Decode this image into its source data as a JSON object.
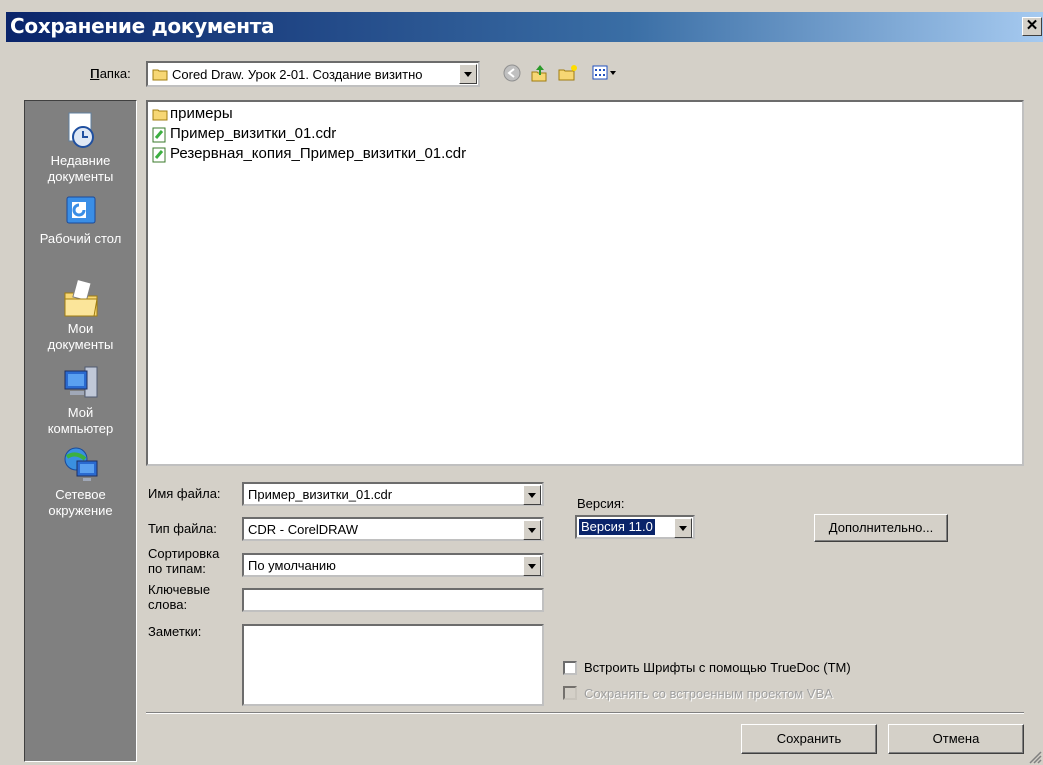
{
  "window": {
    "title": "Сохранение документа",
    "close_glyph": "✕"
  },
  "folder": {
    "label": "Папка:",
    "value": "Cored Draw. Урок 2-01. Создание визитно"
  },
  "places": [
    {
      "label_line1": "Недавние",
      "label_line2": "документы",
      "icon": "recent-docs-icon"
    },
    {
      "label_line1": "Рабочий стол",
      "label_line2": "",
      "icon": "desktop-icon"
    },
    {
      "label_line1": "Мои",
      "label_line2": "документы",
      "icon": "my-documents-icon"
    },
    {
      "label_line1": "Мой",
      "label_line2": "компьютер",
      "icon": "my-computer-icon"
    },
    {
      "label_line1": "Сетевое",
      "label_line2": "окружение",
      "icon": "network-icon"
    }
  ],
  "files": [
    {
      "name": "примеры",
      "type": "folder"
    },
    {
      "name": "Пример_визитки_01.cdr",
      "type": "cdr"
    },
    {
      "name": "Резервная_копия_Пример_визитки_01.cdr",
      "type": "cdr"
    }
  ],
  "form": {
    "filename_label": "Имя файла:",
    "filename_value": "Пример_визитки_01.cdr",
    "filetype_label": "Тип файла:",
    "filetype_value": "CDR - CorelDRAW",
    "sort_label_1": "Сортировка",
    "sort_label_2": "по типам:",
    "sort_value": "По умолчанию",
    "keywords_label_1": "Ключевые",
    "keywords_label_2": "слова:",
    "keywords_value": "",
    "notes_label": "Заметки:",
    "notes_value": ""
  },
  "version": {
    "label": "Версия:",
    "value": "Версия 11.0"
  },
  "buttons": {
    "advanced": "Дополнительно...",
    "save": "Сохранить",
    "cancel": "Отмена"
  },
  "options": {
    "embed_fonts": "Встроить Шрифты с помощью TrueDoc (TM)",
    "save_vba": "Сохранять со встроенным проектом VBA"
  },
  "colors": {
    "title_bar": "#0a246a",
    "places_bg": "#808080",
    "dialog_bg": "#d4d0c8"
  }
}
